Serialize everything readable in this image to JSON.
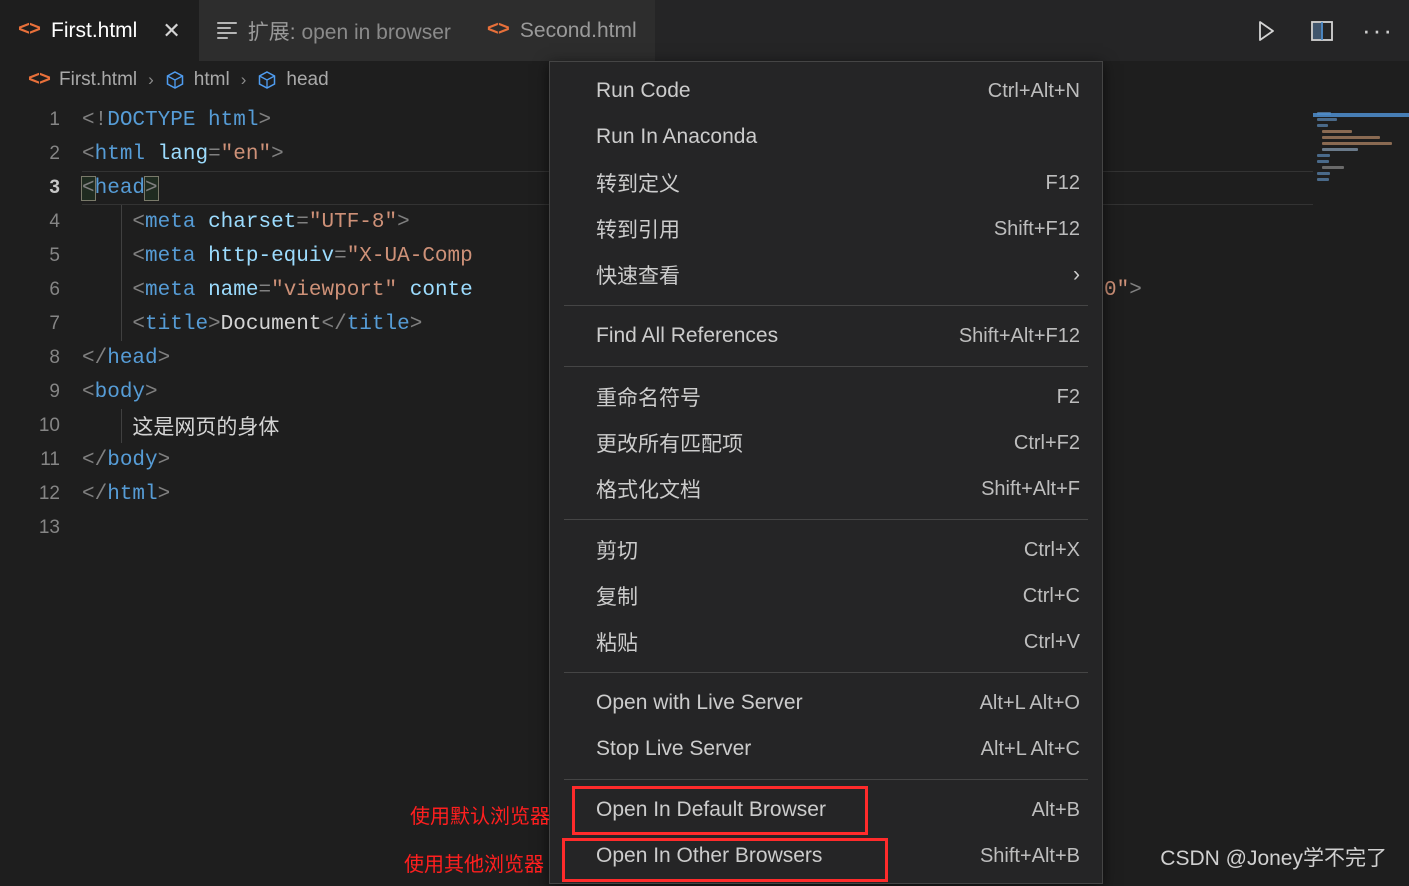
{
  "tabs": [
    {
      "label": "First.html",
      "icon": "html-icon",
      "active": true,
      "closable": true
    },
    {
      "label_prefix": "扩展: ",
      "label": "open in browser",
      "icon": "extension-icon",
      "active": false,
      "closable": false
    },
    {
      "label": "Second.html",
      "icon": "html-icon",
      "active": false,
      "closable": false
    }
  ],
  "tab_actions": [
    {
      "name": "run-button",
      "glyph": "▷"
    },
    {
      "name": "split-editor-button",
      "glyph": "▥"
    },
    {
      "name": "more-actions-button",
      "glyph": "···"
    }
  ],
  "breadcrumb": {
    "file": "First.html",
    "items": [
      "html",
      "head"
    ],
    "separator": "›"
  },
  "editor": {
    "lines": [
      {
        "n": "1",
        "segments": [
          {
            "t": "punc",
            "v": "<!"
          },
          {
            "t": "doct",
            "v": "DOCTYPE"
          },
          {
            "t": "txt",
            "v": " "
          },
          {
            "t": "tag",
            "v": "html"
          },
          {
            "t": "punc",
            "v": ">"
          }
        ]
      },
      {
        "n": "2",
        "segments": [
          {
            "t": "punc",
            "v": "<"
          },
          {
            "t": "tag",
            "v": "html"
          },
          {
            "t": "txt",
            "v": " "
          },
          {
            "t": "attr",
            "v": "lang"
          },
          {
            "t": "punc",
            "v": "="
          },
          {
            "t": "str",
            "v": "\"en\""
          },
          {
            "t": "punc",
            "v": ">"
          }
        ]
      },
      {
        "n": "3",
        "current": true,
        "segments": [
          {
            "t": "box",
            "v": "<"
          },
          {
            "t": "tag",
            "v": "head"
          },
          {
            "t": "box",
            "v": ">"
          }
        ]
      },
      {
        "n": "4",
        "indent": 1,
        "segments": [
          {
            "t": "txt",
            "v": "    "
          },
          {
            "t": "punc",
            "v": "<"
          },
          {
            "t": "tag",
            "v": "meta"
          },
          {
            "t": "txt",
            "v": " "
          },
          {
            "t": "attr",
            "v": "charset"
          },
          {
            "t": "punc",
            "v": "="
          },
          {
            "t": "str",
            "v": "\"UTF-8\""
          },
          {
            "t": "punc",
            "v": ">"
          }
        ]
      },
      {
        "n": "5",
        "indent": 1,
        "segments": [
          {
            "t": "txt",
            "v": "    "
          },
          {
            "t": "punc",
            "v": "<"
          },
          {
            "t": "tag",
            "v": "meta"
          },
          {
            "t": "txt",
            "v": " "
          },
          {
            "t": "attr",
            "v": "http-equiv"
          },
          {
            "t": "punc",
            "v": "="
          },
          {
            "t": "str",
            "v": "\"X-UA-Comp"
          }
        ]
      },
      {
        "n": "6",
        "indent": 1,
        "segments": [
          {
            "t": "txt",
            "v": "    "
          },
          {
            "t": "punc",
            "v": "<"
          },
          {
            "t": "tag",
            "v": "meta"
          },
          {
            "t": "txt",
            "v": " "
          },
          {
            "t": "attr",
            "v": "name"
          },
          {
            "t": "punc",
            "v": "="
          },
          {
            "t": "str",
            "v": "\"viewport\""
          },
          {
            "t": "txt",
            "v": " "
          },
          {
            "t": "attr",
            "v": "conte"
          }
        ]
      },
      {
        "n": "7",
        "indent": 1,
        "segments": [
          {
            "t": "txt",
            "v": "    "
          },
          {
            "t": "punc",
            "v": "<"
          },
          {
            "t": "tag",
            "v": "title"
          },
          {
            "t": "punc",
            "v": ">"
          },
          {
            "t": "txt",
            "v": "Document"
          },
          {
            "t": "punc",
            "v": "</"
          },
          {
            "t": "tag",
            "v": "title"
          },
          {
            "t": "punc",
            "v": ">"
          }
        ]
      },
      {
        "n": "8",
        "segments": [
          {
            "t": "punc",
            "v": "</"
          },
          {
            "t": "tag",
            "v": "head"
          },
          {
            "t": "punc",
            "v": ">"
          }
        ]
      },
      {
        "n": "9",
        "segments": [
          {
            "t": "punc",
            "v": "<"
          },
          {
            "t": "tag",
            "v": "body"
          },
          {
            "t": "punc",
            "v": ">"
          }
        ]
      },
      {
        "n": "10",
        "indent": 1,
        "segments": [
          {
            "t": "txt",
            "v": "    这是网页的身体"
          }
        ]
      },
      {
        "n": "11",
        "segments": [
          {
            "t": "punc",
            "v": "</"
          },
          {
            "t": "tag",
            "v": "body"
          },
          {
            "t": "punc",
            "v": ">"
          }
        ]
      },
      {
        "n": "12",
        "segments": [
          {
            "t": "punc",
            "v": "</"
          },
          {
            "t": "tag",
            "v": "html"
          },
          {
            "t": "punc",
            "v": ">"
          }
        ]
      },
      {
        "n": "13",
        "segments": []
      }
    ],
    "overflow_fragment": {
      "segments": [
        {
          "t": "str",
          "v": "0\""
        },
        {
          "t": "punc",
          "v": ">"
        }
      ]
    }
  },
  "context_menu": {
    "groups": [
      {
        "items": [
          {
            "label": "Run Code",
            "key": "Ctrl+Alt+N"
          },
          {
            "label": "Run In Anaconda",
            "key": ""
          },
          {
            "label": "转到定义",
            "key": "F12"
          },
          {
            "label": "转到引用",
            "key": "Shift+F12"
          },
          {
            "label": "快速查看",
            "key": "",
            "submenu": true,
            "arrow": "›"
          }
        ]
      },
      {
        "items": [
          {
            "label": "Find All References",
            "key": "Shift+Alt+F12"
          }
        ]
      },
      {
        "items": [
          {
            "label": "重命名符号",
            "key": "F2"
          },
          {
            "label": "更改所有匹配项",
            "key": "Ctrl+F2"
          },
          {
            "label": "格式化文档",
            "key": "Shift+Alt+F"
          }
        ]
      },
      {
        "items": [
          {
            "label": "剪切",
            "key": "Ctrl+X"
          },
          {
            "label": "复制",
            "key": "Ctrl+C"
          },
          {
            "label": "粘贴",
            "key": "Ctrl+V"
          }
        ]
      },
      {
        "items": [
          {
            "label": "Open with Live Server",
            "key": "Alt+L Alt+O"
          },
          {
            "label": "Stop Live Server",
            "key": "Alt+L Alt+C"
          }
        ]
      },
      {
        "items": [
          {
            "label": "Open In Default Browser",
            "key": "Alt+B",
            "highlighted": true
          },
          {
            "label": "Open In Other Browsers",
            "key": "Shift+Alt+B",
            "highlighted": true
          }
        ]
      }
    ]
  },
  "annotations": [
    {
      "text": "使用默认浏览器",
      "color": "#ff1f1f"
    },
    {
      "text": "使用其他浏览器",
      "color": "#ff1f1f"
    }
  ],
  "watermark": "CSDN @Joney学不完了",
  "colors": {
    "editor_bg": "#1e1e1e",
    "tabbar_bg": "#252526",
    "menu_bg": "#252526",
    "menu_border": "#454545",
    "accent_orange": "#e8703a",
    "highlight_red": "#ff2b2b"
  }
}
